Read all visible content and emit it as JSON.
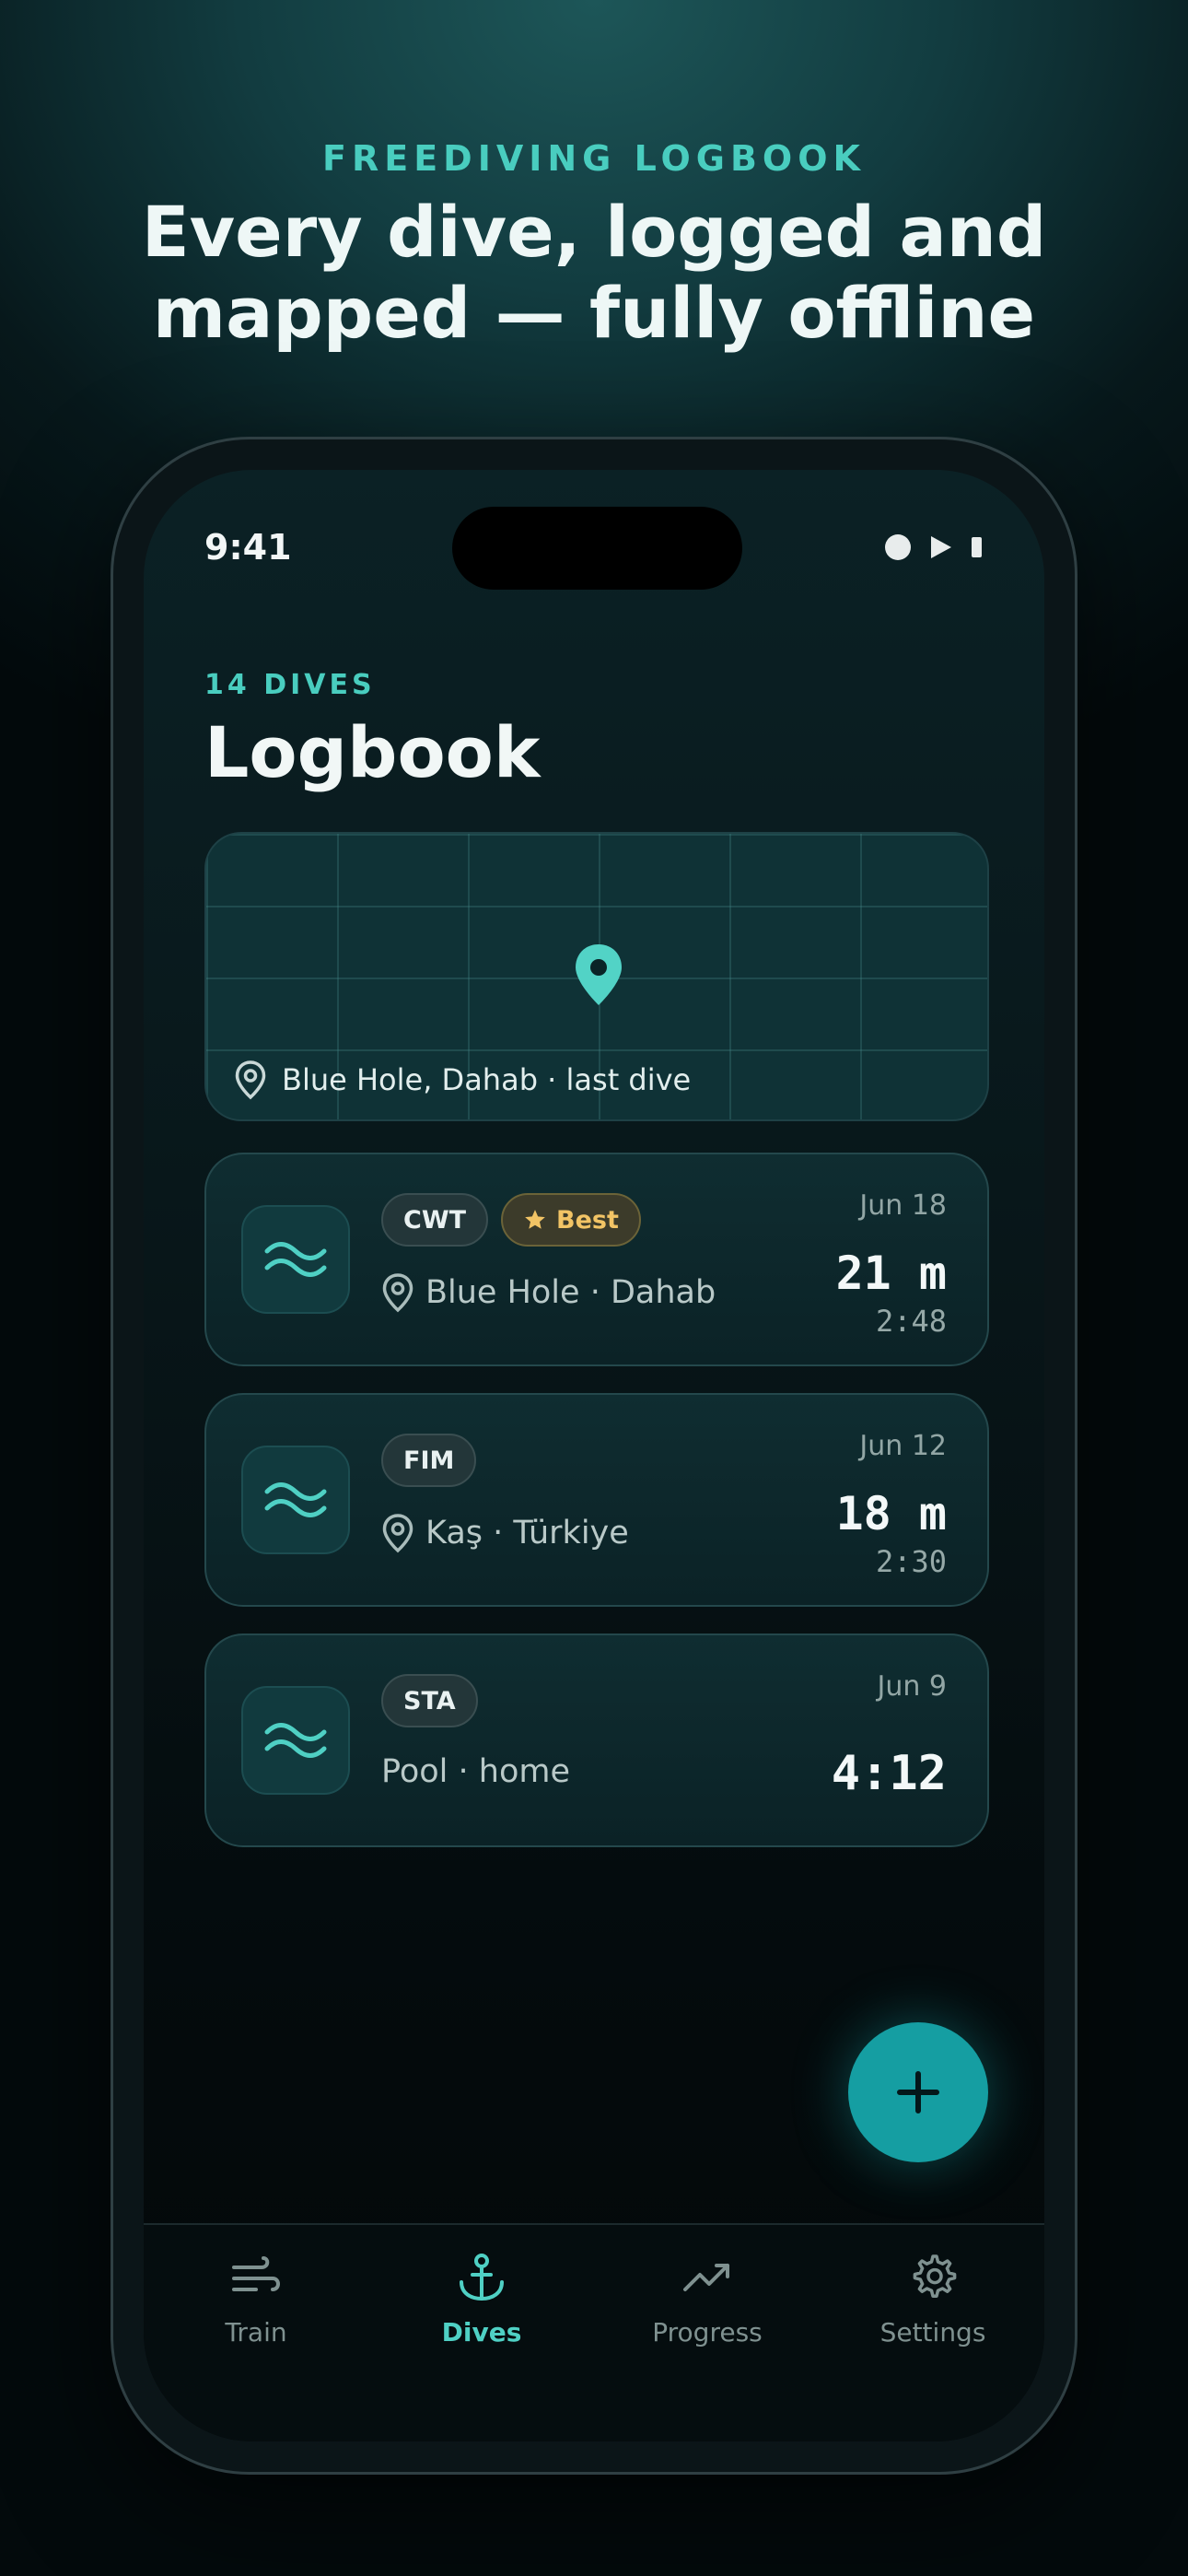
{
  "hero": {
    "kicker": "FREEDIVING LOGBOOK",
    "title_line1": "Every dive, logged and",
    "title_line2": "mapped — fully offline"
  },
  "status_bar": {
    "time": "9:41"
  },
  "header": {
    "count": "14 DIVES",
    "title": "Logbook"
  },
  "map": {
    "label": "Blue Hole, Dahab · last dive",
    "pin_icon": "map-pin-icon"
  },
  "dives": [
    {
      "discipline": "CWT",
      "badge": "Best",
      "location": "Blue Hole · Dahab",
      "date": "Jun 18",
      "depth": "21 m",
      "time": "2:48"
    },
    {
      "discipline": "FIM",
      "location": "Kaş · Türkiye",
      "date": "Jun 12",
      "depth": "18 m",
      "time": "2:30"
    },
    {
      "discipline": "STA",
      "location": "Pool · home",
      "date": "Jun 9",
      "time": "4:12"
    }
  ],
  "tabs": [
    {
      "label": "Train",
      "icon": "wind-icon"
    },
    {
      "label": "Dives",
      "icon": "anchor-icon",
      "active": true
    },
    {
      "label": "Progress",
      "icon": "trend-up-icon"
    },
    {
      "label": "Settings",
      "icon": "gear-icon"
    }
  ],
  "colors": {
    "accent": "#49cdbf",
    "fab": "#159ea2",
    "best_badge": "#f2c465"
  }
}
